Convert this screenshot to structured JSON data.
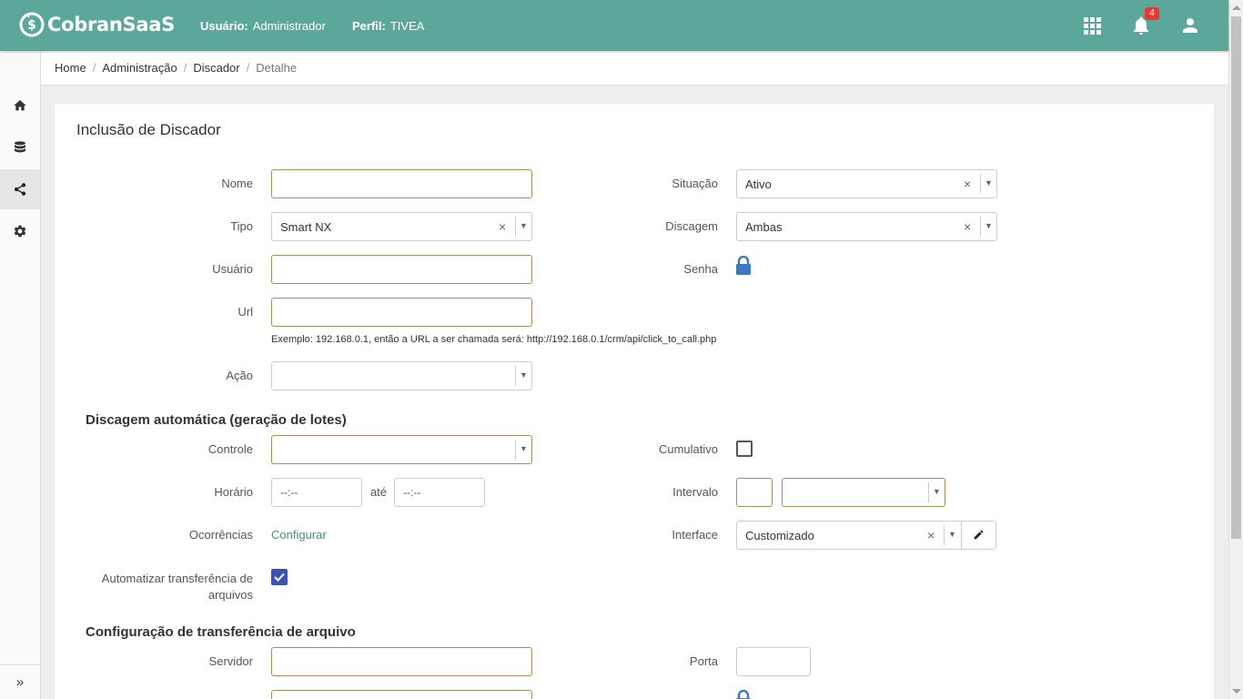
{
  "header": {
    "brand": "CobranSaaS",
    "user_label": "Usuário:",
    "user_value": "Administrador",
    "profile_label": "Perfil:",
    "profile_value": "TIVEA",
    "notification_count": "4",
    "bg_color": "#5ba79a"
  },
  "sidebar": {
    "items": [
      {
        "icon": "home-icon"
      },
      {
        "icon": "database-icon"
      },
      {
        "icon": "share-icon",
        "active": true
      },
      {
        "icon": "gear-icon"
      }
    ],
    "expand_label": "»"
  },
  "breadcrumb": {
    "items": [
      "Home",
      "Administração",
      "Discador"
    ],
    "current": "Detalhe",
    "separator": "/"
  },
  "form": {
    "title": "Inclusão de Discador",
    "nome": {
      "label": "Nome",
      "value": ""
    },
    "tipo": {
      "label": "Tipo",
      "value": "Smart NX"
    },
    "usuario": {
      "label": "Usuário",
      "value": ""
    },
    "url": {
      "label": "Url",
      "value": "",
      "hint": "Exemplo: 192.168.0.1, então a URL a ser chamada será: http://192.168.0.1/crm/api/click_to_call.php"
    },
    "acao": {
      "label": "Ação",
      "value": ""
    },
    "situacao": {
      "label": "Situação",
      "value": "Ativo"
    },
    "discagem": {
      "label": "Discagem",
      "value": "Ambas"
    },
    "senha": {
      "label": "Senha",
      "icon": "lock-icon"
    },
    "section_auto": "Discagem automática (geração de lotes)",
    "controle": {
      "label": "Controle",
      "value": ""
    },
    "horario": {
      "label": "Horário",
      "from": "--:--",
      "sep": "até",
      "to": "--:--"
    },
    "ocorrencias": {
      "label": "Ocorrências",
      "link": "Configurar"
    },
    "automatizar": {
      "label_line1": "Automatizar transferência de",
      "label_line2": "arquivos",
      "checked": true
    },
    "cumulativo": {
      "label": "Cumulativo",
      "checked": false
    },
    "intervalo": {
      "label": "Intervalo",
      "value": "",
      "unit": ""
    },
    "interface": {
      "label": "Interface",
      "value": "Customizado"
    },
    "section_transfer": "Configuração de transferência de arquivo",
    "servidor": {
      "label": "Servidor",
      "value": ""
    },
    "porta": {
      "label": "Porta",
      "value": ""
    }
  },
  "colors": {
    "accent": "#5ba79a",
    "field_border": "#a78d57",
    "link": "#3f8f88",
    "checkbox": "#3f51b5",
    "badge": "#e53935"
  }
}
